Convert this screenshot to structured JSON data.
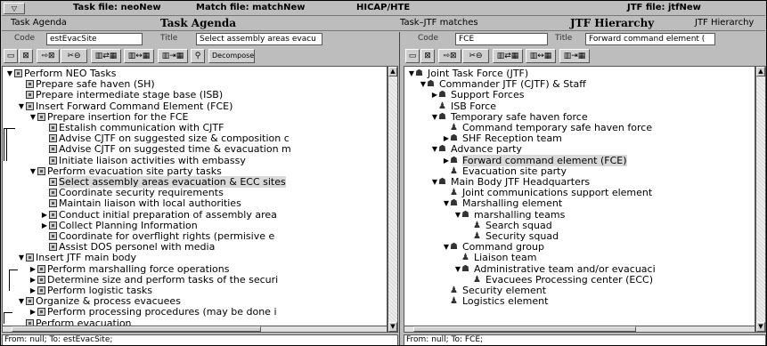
{
  "title_bar": {
    "task_file": "Task file: neoNew",
    "match_file": "Match file: matchNew",
    "hicap": "HICAP/HTE",
    "jtf_file": "JTF file: jtfNew"
  },
  "header": {
    "task_agenda_small": "Task Agenda",
    "task_agenda_big": "Task Agenda",
    "matches": "Task–JTF matches",
    "jtf_hierarchy_big": "JTF Hierarchy",
    "jtf_hierarchy_small": "JTF Hierarchy"
  },
  "left": {
    "code_label": "Code",
    "code_value": "estEvacSite",
    "title_label": "Title",
    "title_value": "Select assembly areas evacu",
    "decompose_label": "Decompose",
    "status": "From: null; To: estEvacSite;",
    "tree": [
      {
        "label": "Perform NEO Tasks",
        "toggle": "▼"
      },
      {
        "label": "Prepare safe haven (SH)",
        "toggle": ""
      },
      {
        "label": "Prepare intermediate stage base (ISB)",
        "toggle": ""
      },
      {
        "label": "Insert Forward Command Element (FCE)",
        "toggle": "▼"
      },
      {
        "label": "Prepare insertion for the FCE",
        "toggle": "▼"
      },
      {
        "label": "Estalish communication with CJTF",
        "toggle": ""
      },
      {
        "label": "Advise CJTF on suggested size & composition c",
        "toggle": ""
      },
      {
        "label": "Advise CJTF on suggested time & evacuation m",
        "toggle": ""
      },
      {
        "label": "Initiate liaison activities with embassy",
        "toggle": ""
      },
      {
        "label": "Perform evacuation site party tasks",
        "toggle": "▼"
      },
      {
        "label": "Select assembly areas evacuation & ECC sites",
        "toggle": "",
        "selected": true
      },
      {
        "label": "Coordinate security requirements",
        "toggle": ""
      },
      {
        "label": "Maintain liaison with local authorities",
        "toggle": ""
      },
      {
        "label": "Conduct initial preparation of assembly area",
        "toggle": "▶"
      },
      {
        "label": "Collect Planning Information",
        "toggle": "▶"
      },
      {
        "label": "Coordinate for overflight rights (permisive e",
        "toggle": ""
      },
      {
        "label": "Assist DOS personel with media",
        "toggle": ""
      },
      {
        "label": "Insert JTF main body",
        "toggle": "▼"
      },
      {
        "label": "Perform marshalling force operations",
        "toggle": "▶"
      },
      {
        "label": "Determine size and perform tasks of the securi",
        "toggle": "▶"
      },
      {
        "label": "Perform logistic tasks",
        "toggle": "▶"
      },
      {
        "label": "Organize & process evacuees",
        "toggle": "▼"
      },
      {
        "label": "Perform processing procedures (may be done i",
        "toggle": "▶"
      },
      {
        "label": "Perform evacuation",
        "toggle": ""
      }
    ]
  },
  "right": {
    "code_label": "Code",
    "code_value": "FCE",
    "title_label": "Title",
    "title_value": "Forward command element (",
    "status": "From: null; To: FCE;",
    "tree": [
      {
        "label": "Joint Task Force (JTF)",
        "toggle": "▼",
        "icon": "group"
      },
      {
        "label": "Commander JTF (CJTF) & Staff",
        "toggle": "▼",
        "icon": "group"
      },
      {
        "label": "Support Forces",
        "toggle": "▶",
        "icon": "group"
      },
      {
        "label": "ISB Force",
        "toggle": "",
        "icon": "person"
      },
      {
        "label": "Temporary safe haven force",
        "toggle": "▼",
        "icon": "group"
      },
      {
        "label": "Command temporary safe haven force",
        "toggle": "",
        "icon": "person"
      },
      {
        "label": "SHF Reception team",
        "toggle": "▶",
        "icon": "group"
      },
      {
        "label": "Advance party",
        "toggle": "▼",
        "icon": "group"
      },
      {
        "label": "Forward command element (FCE)",
        "toggle": "▶",
        "icon": "group",
        "selected": true
      },
      {
        "label": "Evacuation site party",
        "toggle": "",
        "icon": "person"
      },
      {
        "label": "Main Body JTF Headquarters",
        "toggle": "▼",
        "icon": "group"
      },
      {
        "label": "Joint communications support element",
        "toggle": "",
        "icon": "person"
      },
      {
        "label": "Marshalling element",
        "toggle": "▼",
        "icon": "group"
      },
      {
        "label": "marshalling teams",
        "toggle": "▼",
        "icon": "group"
      },
      {
        "label": "Search squad",
        "toggle": "",
        "icon": "person"
      },
      {
        "label": "Security squad",
        "toggle": "",
        "icon": "person"
      },
      {
        "label": "Command group",
        "toggle": "▼",
        "icon": "group"
      },
      {
        "label": "Liaison team",
        "toggle": "",
        "icon": "person"
      },
      {
        "label": "Administrative team and/or evacuaci",
        "toggle": "▼",
        "icon": "group"
      },
      {
        "label": "Evacuees Processing center (ECC)",
        "toggle": "",
        "icon": "person"
      },
      {
        "label": "Security element",
        "toggle": "",
        "icon": "person"
      },
      {
        "label": "Logistics element",
        "toggle": "",
        "icon": "person"
      }
    ]
  }
}
